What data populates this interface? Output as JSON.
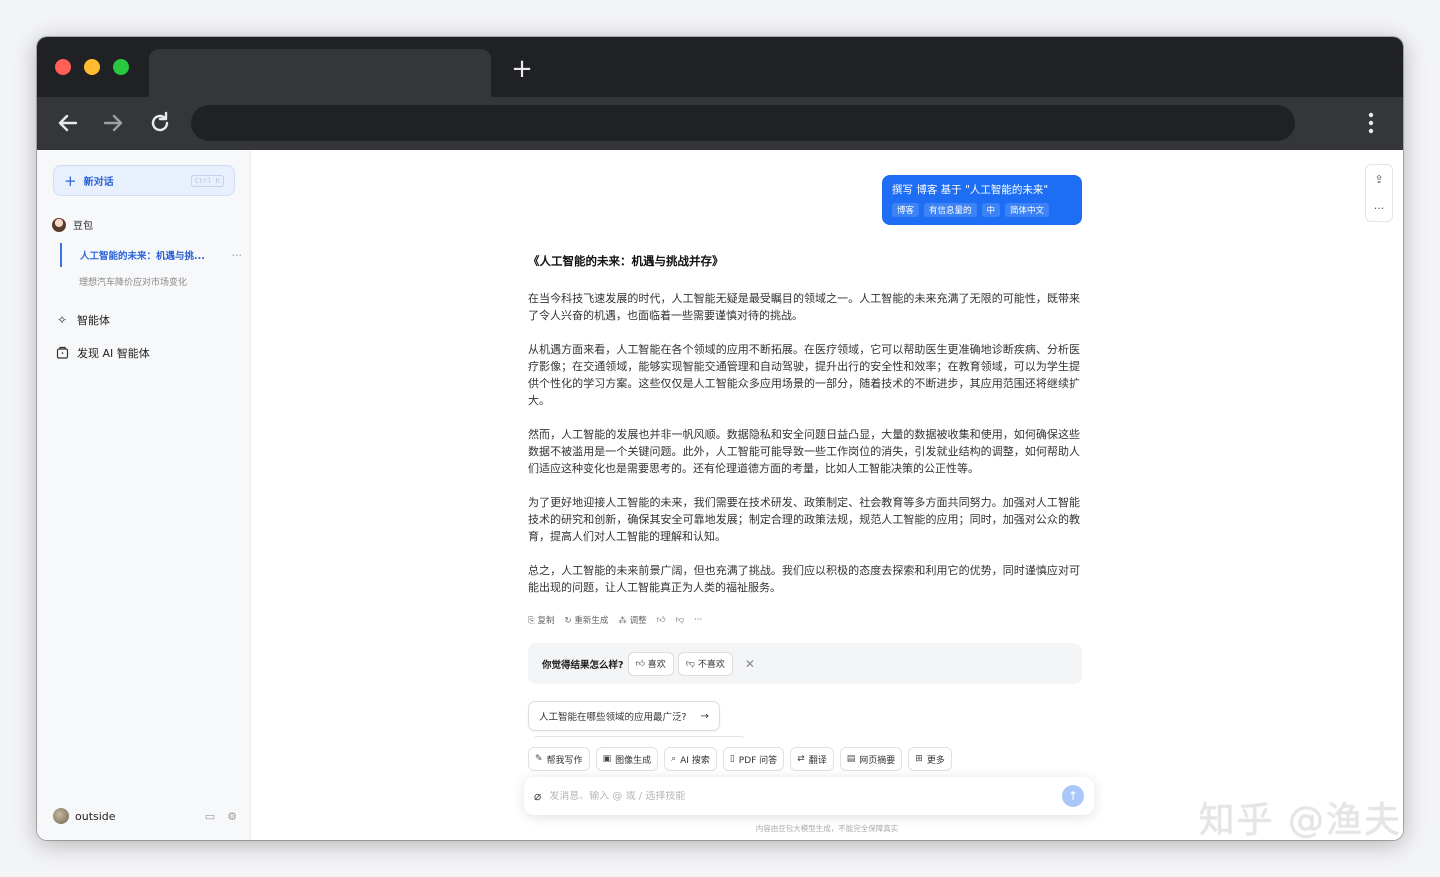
{
  "sidebar": {
    "new_chat": {
      "label": "新对话",
      "shortcut": "Ctrl K"
    },
    "bot_name": "豆包",
    "conversations": [
      {
        "title": "人工智能的未来：机遇与挑...",
        "more": "···"
      },
      {
        "title": "理想汽车降价应对市场变化"
      }
    ],
    "nav": [
      {
        "label": "智能体",
        "icon": "sparkle-icon"
      },
      {
        "label": "发现 AI 智能体",
        "icon": "discover-icon"
      }
    ],
    "user": {
      "name": "outside"
    }
  },
  "chat": {
    "user_message": {
      "text": "撰写 博客 基于 \"人工智能的未来\"",
      "chips": [
        "博客",
        "有信息量的",
        "中",
        "简体中文"
      ]
    },
    "article": {
      "title": "《人工智能的未来：机遇与挑战并存》",
      "paragraphs": [
        "在当今科技飞速发展的时代，人工智能无疑是最受瞩目的领域之一。人工智能的未来充满了无限的可能性，既带来了令人兴奋的机遇，也面临着一些需要谨慎对待的挑战。",
        "从机遇方面来看，人工智能在各个领域的应用不断拓展。在医疗领域，它可以帮助医生更准确地诊断疾病、分析医疗影像；在交通领域，能够实现智能交通管理和自动驾驶，提升出行的安全性和效率；在教育领域，可以为学生提供个性化的学习方案。这些仅仅是人工智能众多应用场景的一部分，随着技术的不断进步，其应用范围还将继续扩大。",
        "然而，人工智能的发展也并非一帆风顺。数据隐私和安全问题日益凸显，大量的数据被收集和使用，如何确保这些数据不被滥用是一个关键问题。此外，人工智能可能导致一些工作岗位的消失，引发就业结构的调整，如何帮助人们适应这种变化也是需要思考的。还有伦理道德方面的考量，比如人工智能决策的公正性等。",
        "为了更好地迎接人工智能的未来，我们需要在技术研发、政策制定、社会教育等多方面共同努力。加强对人工智能技术的研究和创新，确保其安全可靠地发展；制定合理的政策法规，规范人工智能的应用；同时，加强对公众的教育，提高人们对人工智能的理解和认知。",
        "总之，人工智能的未来前景广阔，但也充满了挑战。我们应以积极的态度去探索和利用它的优势，同时谨慎应对可能出现的问题，让人工智能真正为人类的福祉服务。"
      ]
    },
    "actions": {
      "copy": "复制",
      "regenerate": "重新生成",
      "adjust": "调整",
      "more": "···"
    },
    "feedback": {
      "question": "你觉得结果怎么样?",
      "like": "喜欢",
      "dislike": "不喜欢",
      "close": "✕"
    },
    "suggestion": "人工智能在哪些领域的应用最广泛?",
    "skills": [
      {
        "label": "帮我写作",
        "icon": "pen-icon"
      },
      {
        "label": "图像生成",
        "icon": "image-icon"
      },
      {
        "label": "AI 搜索",
        "icon": "search-icon"
      },
      {
        "label": "PDF 问答",
        "icon": "book-icon"
      },
      {
        "label": "翻译",
        "icon": "translate-icon"
      },
      {
        "label": "网页摘要",
        "icon": "page-icon"
      },
      {
        "label": "更多",
        "icon": "grid-icon"
      }
    ],
    "composer_placeholder": "发消息、输入 @ 或 / 选择技能",
    "disclaimer": "内容由豆包大模型生成，不能完全保障真实"
  },
  "watermark": "知乎 @渔夫",
  "colors": {
    "accent": "#1e6ef5",
    "chrome_dark": "#202124",
    "chrome_bar": "#35363a"
  }
}
